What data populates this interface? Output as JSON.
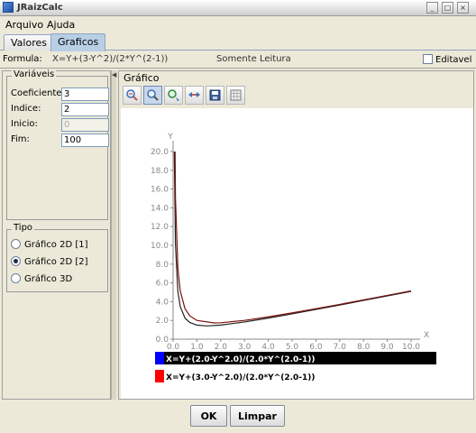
{
  "window": {
    "title": "JRaizCalc",
    "controls": [
      "_",
      "□",
      "×"
    ]
  },
  "menu": [
    {
      "label": "Arquivo"
    },
    {
      "label": "Ajuda"
    }
  ],
  "tabs": [
    {
      "label": "Valores",
      "active": false
    },
    {
      "label": "Graficos",
      "active": true
    }
  ],
  "formula": {
    "label": "Formula:",
    "value": "X=Y+(3-Y^2)/(2*Y^(2-1))",
    "note": "Somente Leitura",
    "editable_label": "Editavel",
    "editable_checked": false
  },
  "variables": {
    "title": "Variáveis",
    "fields": [
      {
        "label": "Coeficiente:",
        "value": "3",
        "enabled": true
      },
      {
        "label": "Indice:",
        "value": "2",
        "enabled": true
      },
      {
        "label": "Inicio:",
        "value": "0",
        "enabled": false
      },
      {
        "label": "Fim:",
        "value": "100",
        "enabled": true
      }
    ]
  },
  "tipo": {
    "title": "Tipo",
    "options": [
      {
        "label": "Gráfico 2D [1]",
        "checked": false
      },
      {
        "label": "Gráfico 2D [2]",
        "checked": true
      },
      {
        "label": "Gráfico 3D",
        "checked": false
      }
    ]
  },
  "grafico": {
    "title": "Gráfico",
    "tools": [
      {
        "icon": "zoom-fit-icon",
        "pressed": false
      },
      {
        "icon": "zoom-icon",
        "pressed": true
      },
      {
        "icon": "pan-icon",
        "pressed": false
      },
      {
        "icon": "move-icon",
        "pressed": false
      },
      {
        "icon": "save-icon",
        "pressed": false
      },
      {
        "icon": "grid-icon",
        "pressed": false
      }
    ]
  },
  "chart_data": {
    "type": "line",
    "xlabel": "X",
    "ylabel": "Y",
    "xlim": [
      0,
      10
    ],
    "ylim": [
      0,
      20
    ],
    "x_ticks": [
      "0.0",
      "1.0",
      "2.0",
      "3.0",
      "4.0",
      "5.0",
      "6.0",
      "7.0",
      "8.0",
      "9.0",
      "10.0"
    ],
    "y_ticks": [
      "0.0",
      "2.0",
      "4.0",
      "6.0",
      "8.0",
      "10.0",
      "12.0",
      "14.0",
      "16.0",
      "18.0",
      "20.0"
    ],
    "grid": false,
    "legend_position": "bottom",
    "series": [
      {
        "name": "X=Y+(2.0-Y^2.0)/(2.0*Y^(2.0-1))",
        "color": "#0000ff",
        "coefficient": 2,
        "index": 2,
        "x": [
          0.05,
          0.1,
          0.2,
          0.3,
          0.5,
          0.7,
          1.0,
          1.414,
          2.0,
          3.0,
          4.0,
          5.0,
          6.0,
          7.0,
          8.0,
          9.0,
          10.0
        ],
        "y": [
          20.02,
          10.05,
          5.1,
          3.48,
          2.25,
          1.78,
          1.5,
          1.414,
          1.5,
          1.83,
          2.25,
          2.7,
          3.17,
          3.64,
          4.13,
          4.61,
          5.1
        ]
      },
      {
        "name": "X=Y+(3.0-Y^2.0)/(2.0*Y^(2.0-1))",
        "color": "#ff0000",
        "coefficient": 3,
        "index": 2,
        "x": [
          0.05,
          0.1,
          0.2,
          0.3,
          0.5,
          0.7,
          1.0,
          1.732,
          2.0,
          3.0,
          4.0,
          5.0,
          6.0,
          7.0,
          8.0,
          9.0,
          10.0
        ],
        "y": [
          30.03,
          15.05,
          7.6,
          5.15,
          3.25,
          2.49,
          2.0,
          1.732,
          1.75,
          2.0,
          2.38,
          2.8,
          3.25,
          3.71,
          4.19,
          4.67,
          5.15
        ]
      }
    ],
    "legend_colors": {
      "blue_row_background": "#000000"
    }
  },
  "buttons": {
    "ok": "OK",
    "clear": "Limpar"
  }
}
